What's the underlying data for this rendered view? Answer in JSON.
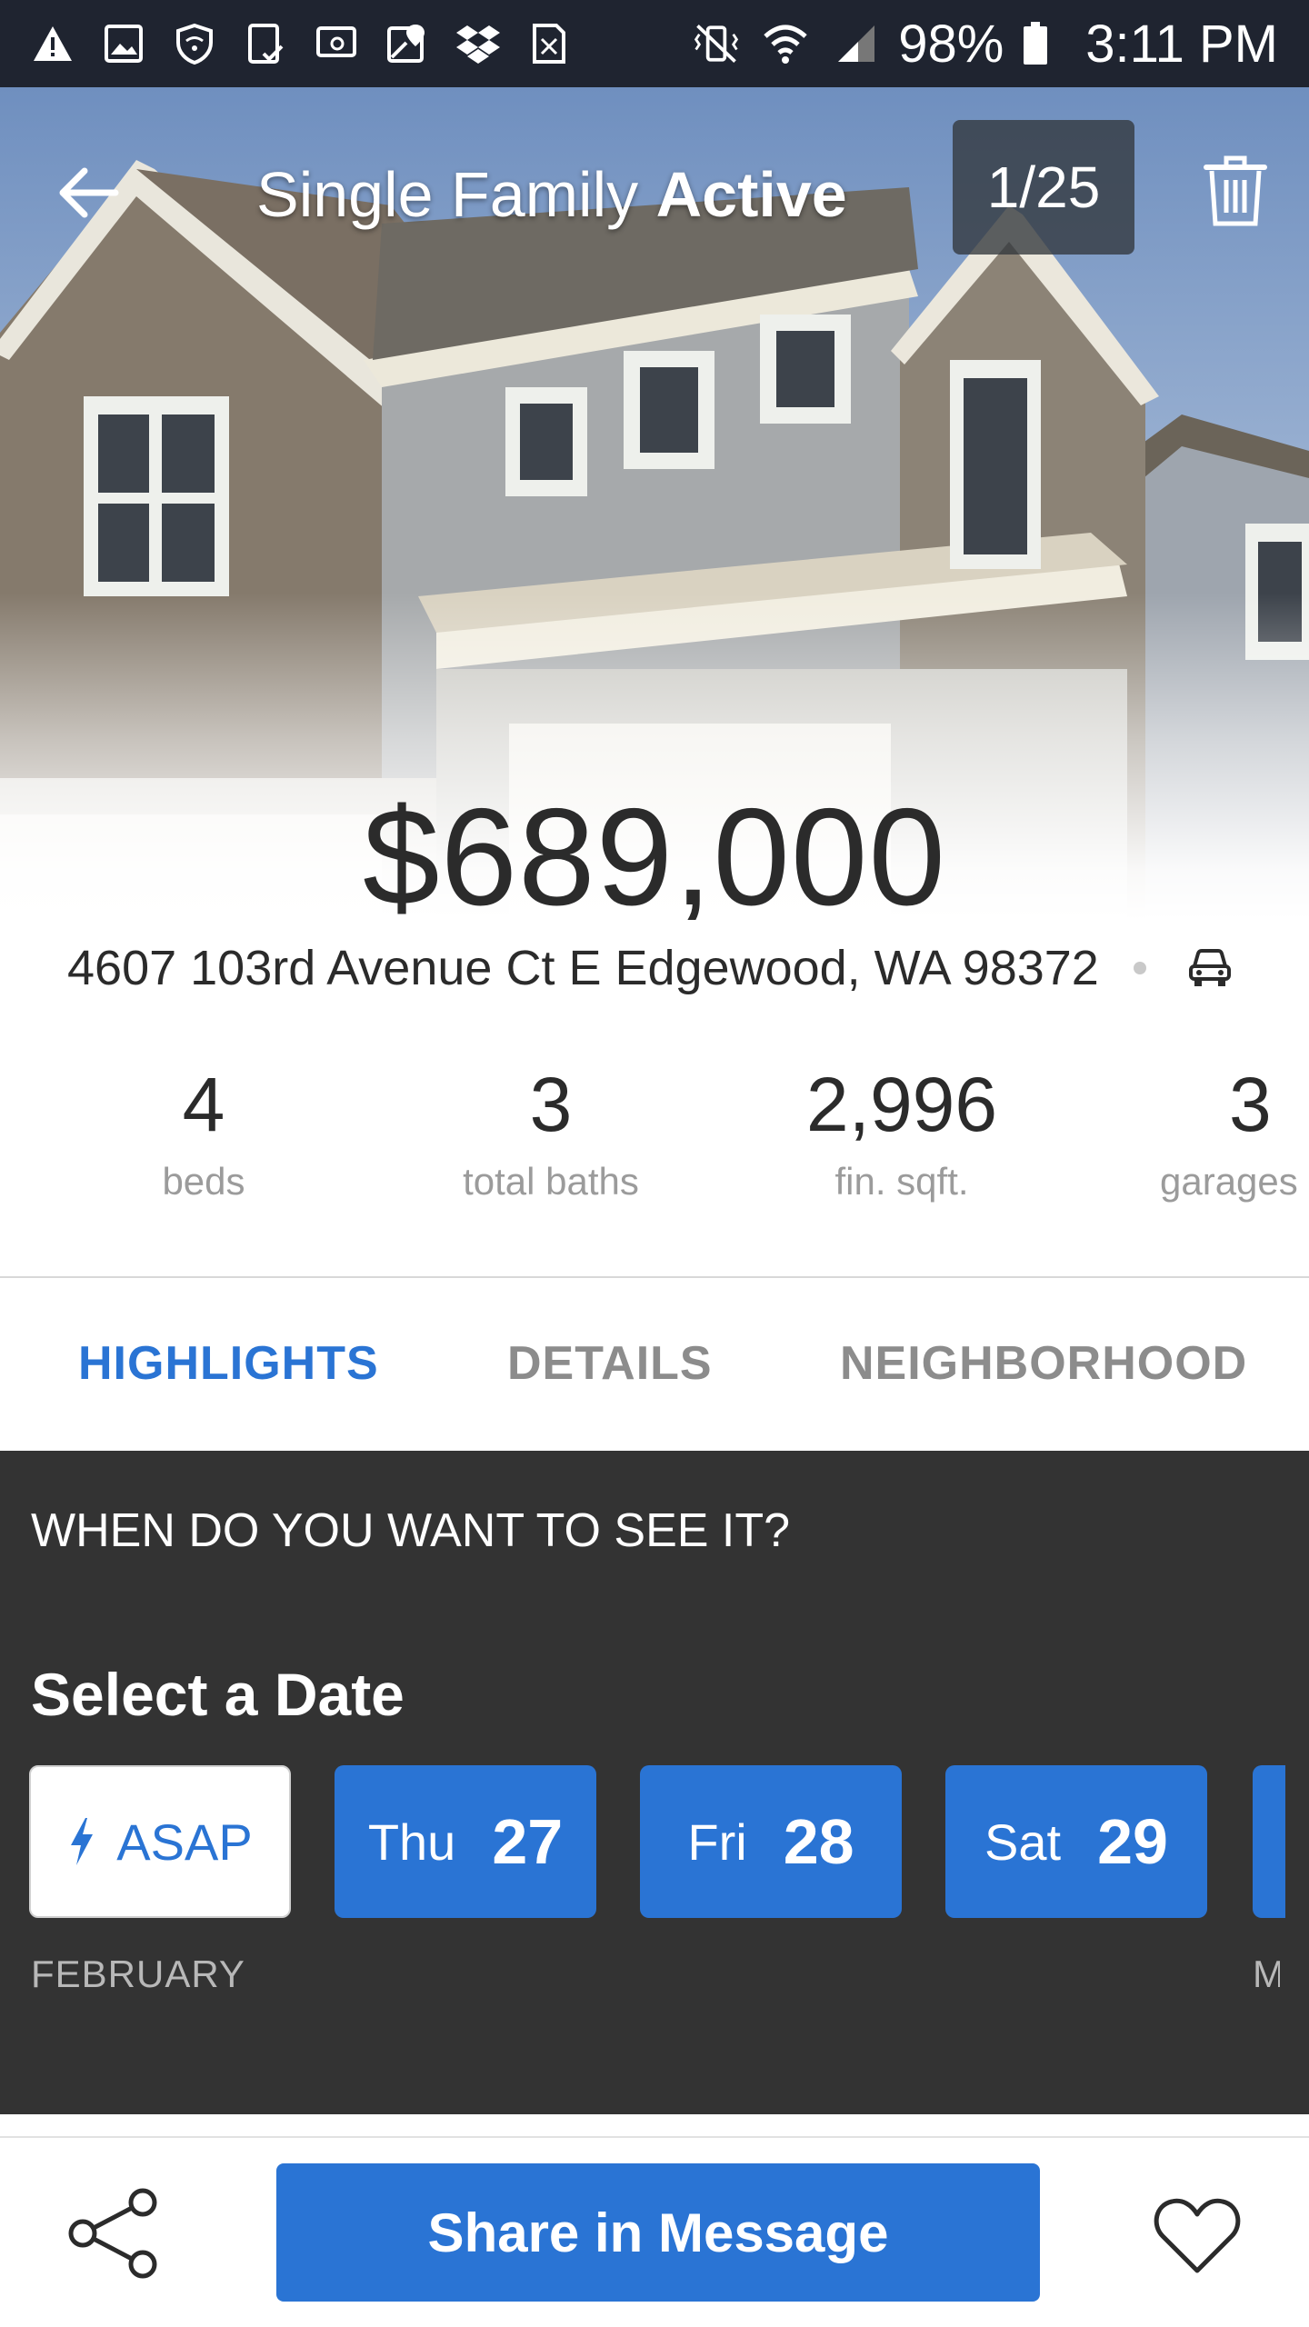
{
  "status_bar": {
    "left_icons": [
      "warning-icon",
      "image-icon",
      "wifi-shield-icon",
      "tablet-check-icon",
      "cast-icon",
      "map-icon",
      "dropbox-icon",
      "sim-icon"
    ],
    "right_icons": [
      "vibrate-off-icon",
      "wifi-icon",
      "signal-icon",
      "battery-icon"
    ],
    "battery": "98%",
    "time": "3:11 PM"
  },
  "header": {
    "title_type": "Single Family",
    "title_status": "Active",
    "photo_counter": "1/25"
  },
  "listing": {
    "price": "$689,000",
    "address": "4607 103rd Avenue Ct E Edgewood, WA 98372"
  },
  "stats": [
    {
      "value": "4",
      "label": "beds"
    },
    {
      "value": "3",
      "label": "total baths"
    },
    {
      "value": "2,996",
      "label": "fin. sqft."
    },
    {
      "value": "3",
      "label": "garages"
    }
  ],
  "tabs": [
    {
      "label": "HIGHLIGHTS",
      "active": true
    },
    {
      "label": "DETAILS",
      "active": false
    },
    {
      "label": "NEIGHBORHOOD",
      "active": false
    }
  ],
  "schedule": {
    "question": "WHEN DO YOU WANT TO SEE IT?",
    "select_label": "Select a Date",
    "asap_label": "ASAP",
    "dates": [
      {
        "day": "Thu",
        "num": "27"
      },
      {
        "day": "Fri",
        "num": "28"
      },
      {
        "day": "Sat",
        "num": "29"
      }
    ],
    "month_label": "FEBRUARY",
    "next_month_partial": "M"
  },
  "bottom": {
    "cta_label": "Share in Message"
  },
  "colors": {
    "accent": "#2a74d4",
    "panel": "#333333",
    "status_bar": "#1f2430"
  }
}
